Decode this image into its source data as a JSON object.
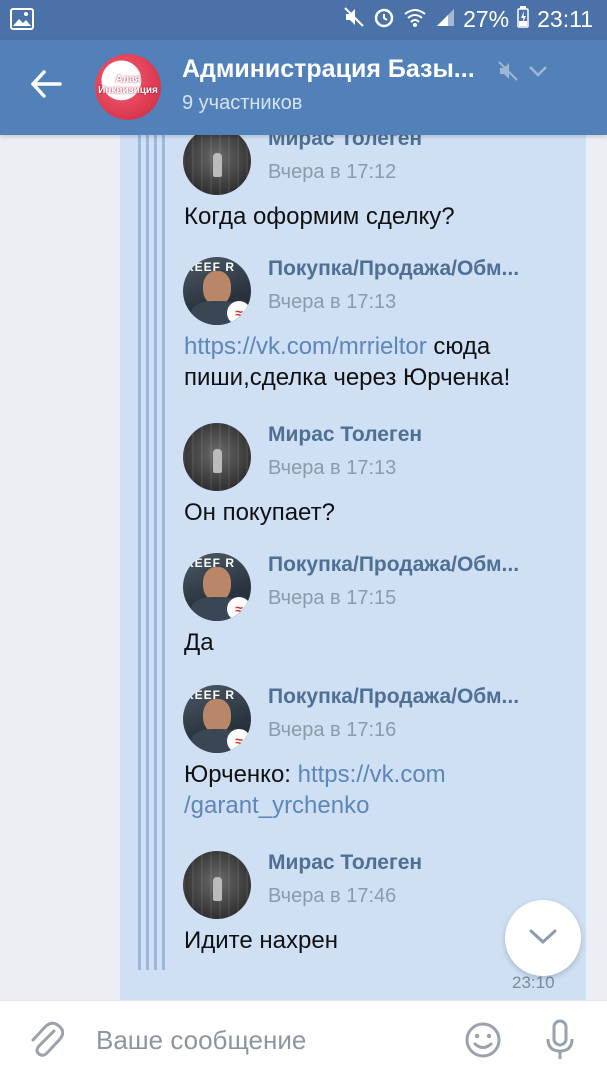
{
  "status_bar": {
    "battery": "27%",
    "time": "23:11",
    "icons": [
      "image-icon",
      "mute-icon",
      "alarm-icon",
      "wifi-icon",
      "signal-icon",
      "battery-icon"
    ]
  },
  "header": {
    "title": "Администрация Базы...",
    "subtitle": "9 участников",
    "avatar_text": "Алая Инквизиция",
    "colors": {
      "bar": "#5181b8",
      "status": "#4a72a8"
    }
  },
  "messages": [
    {
      "author": "Мирас Толеген",
      "time": "Вчера в 17:12",
      "text": "Когда оформим сделку?",
      "avatar": "miras"
    },
    {
      "author": "Покупка/Продажа/Обм...",
      "time": "Вчера в 17:13",
      "link": "https://vk.com/mrrieltor",
      "text": " сюда пиши,сделка через Юрченка!",
      "avatar": "shop"
    },
    {
      "author": "Мирас Толеген",
      "time": "Вчера в 17:13",
      "text": "Он покупает?",
      "avatar": "miras"
    },
    {
      "author": "Покупка/Продажа/Обм...",
      "time": "Вчера в 17:15",
      "text": "Да",
      "avatar": "shop"
    },
    {
      "author": "Покупка/Продажа/Обм...",
      "time": "Вчера в 17:16",
      "prefix": "Юрченко: ",
      "link": "https://vk.com /garant_yrchenko",
      "avatar": "shop"
    },
    {
      "author": "Мирас Толеген",
      "time": "Вчера в 17:46",
      "text": "Идите нахрен",
      "avatar": "miras"
    }
  ],
  "avatar_words": {
    "shop": "REEF R"
  },
  "bubble_time": "23:10",
  "composer": {
    "placeholder": "Ваше сообщение"
  }
}
